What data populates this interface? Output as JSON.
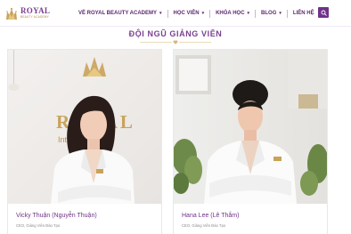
{
  "brand": {
    "name": "ROYAL",
    "tagline": "BEAUTY ACADEMY",
    "accent_color": "#6f3289",
    "gold_color": "#c9a25a"
  },
  "nav": {
    "items": [
      {
        "label": "VỀ ROYAL BEAUTY ACADEMY",
        "has_dropdown": true
      },
      {
        "label": "HỌC VIÊN",
        "has_dropdown": true
      },
      {
        "label": "KHÓA HỌC",
        "has_dropdown": true
      },
      {
        "label": "BLOG",
        "has_dropdown": true
      },
      {
        "label": "LIÊN HỆ",
        "has_dropdown": false
      }
    ],
    "search_icon": "search-icon"
  },
  "section": {
    "title": "ĐỘI NGŨ GIẢNG VIÊN"
  },
  "instructors": [
    {
      "name": "Vicky Thuận (Nguyễn Thuận)",
      "role": "CEO, Giảng Viên Đào Tạo",
      "backdrop_logo": "ROYAL",
      "backdrop_sub": "Int           linic"
    },
    {
      "name": "Hana Lee (Lê Thắm)",
      "role": "CEO, Giảng Viên Đào Tạo"
    }
  ]
}
